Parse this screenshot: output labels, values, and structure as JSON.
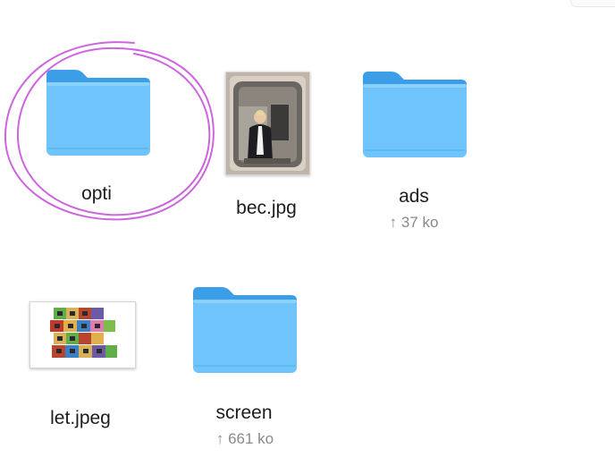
{
  "files": [
    {
      "name": "opti",
      "kind": "folder",
      "size": ""
    },
    {
      "name": "bec.jpg",
      "kind": "image",
      "size": ""
    },
    {
      "name": "ads",
      "kind": "folder",
      "size": "↑ 37 ko"
    },
    {
      "name": "let.jpeg",
      "kind": "image",
      "size": ""
    },
    {
      "name": "screen",
      "kind": "folder",
      "size": "↑ 661 ko"
    }
  ],
  "thumbnails": {
    "let_blocks_text": "LET TOYS BE TOYS"
  },
  "colors": {
    "folder_body": "#6fc5fb",
    "folder_tab": "#3d9ee8",
    "annotation": "#cc66dd"
  }
}
